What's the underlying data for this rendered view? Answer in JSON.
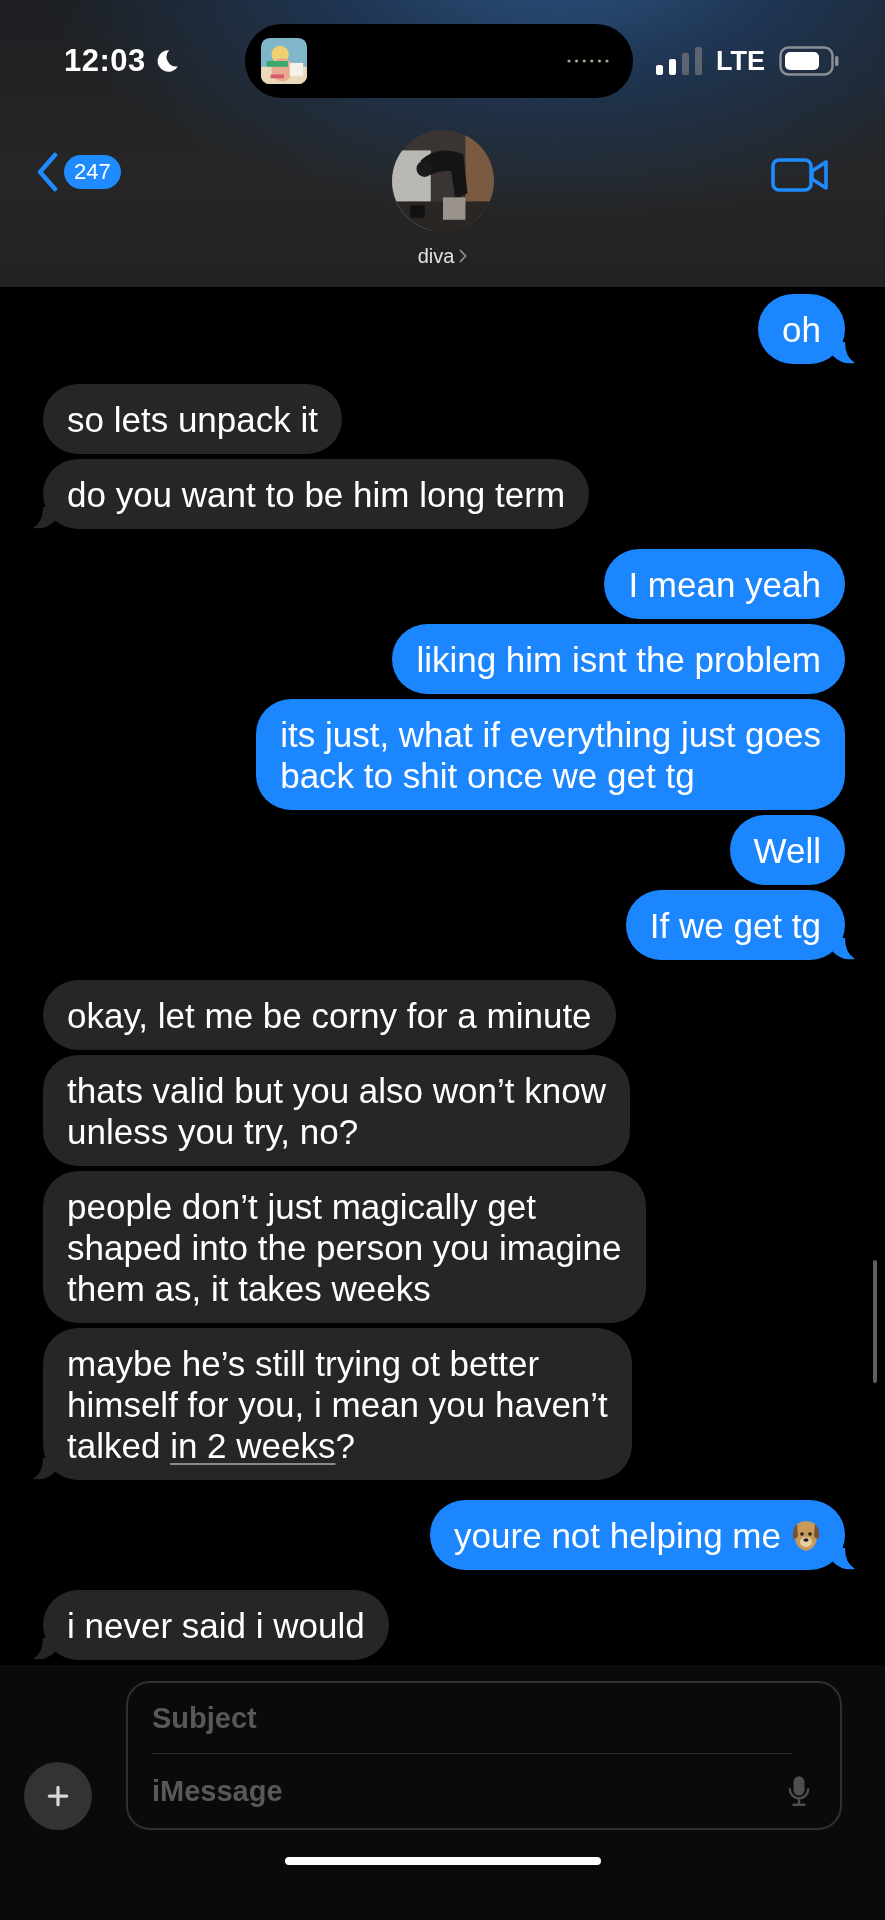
{
  "status_bar": {
    "time": "12:03",
    "network": "LTE"
  },
  "nav": {
    "back_badge": "247",
    "contact_name": "diva"
  },
  "messages": [
    {
      "kind": "sent",
      "text": "oh"
    },
    {
      "kind": "received",
      "text": "so lets unpack it"
    },
    {
      "kind": "received",
      "text": "do you want to be him long term"
    },
    {
      "kind": "sent",
      "text": "I mean yeah"
    },
    {
      "kind": "sent",
      "text": "liking him isnt the problem"
    },
    {
      "kind": "sent",
      "text": "its just, what if everything just goes\nback to shit once we get tg"
    },
    {
      "kind": "sent",
      "text": "Well"
    },
    {
      "kind": "sent",
      "text": "If we get tg"
    },
    {
      "kind": "received",
      "text": "okay, let me be corny for a minute"
    },
    {
      "kind": "received",
      "text": "thats valid but you also won’t know\nunless you try, no?"
    },
    {
      "kind": "received",
      "text": "people don’t just magically get\nshaped into the person you imagine\nthem as, it takes weeks"
    },
    {
      "kind": "received",
      "parts": [
        {
          "text": "maybe he’s still trying ot better\nhimself for you, i mean you haven’t\ntalked ",
          "link": false
        },
        {
          "text": "in 2 weeks",
          "link": true
        },
        {
          "text": "?",
          "link": false
        }
      ]
    },
    {
      "kind": "sent",
      "text": "youre not helping me",
      "sticker": true
    },
    {
      "kind": "received",
      "text": "i never said i would"
    }
  ],
  "composer": {
    "subject_placeholder": "Subject",
    "message_placeholder": "iMessage"
  }
}
